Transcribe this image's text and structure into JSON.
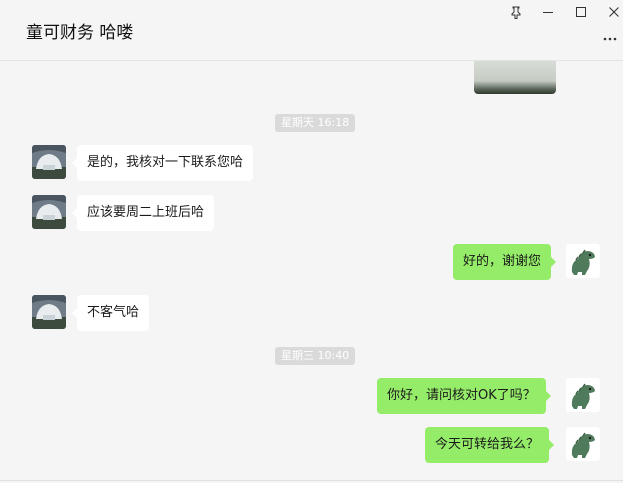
{
  "header": {
    "title": "童可财务 哈喽",
    "pin_icon": "pin-icon",
    "min_icon": "minimize-icon",
    "max_icon": "maximize-icon",
    "close_icon": "close-icon",
    "more_icon": "more-icon"
  },
  "timestamps": [
    "星期天 16:18",
    "星期三 10:40"
  ],
  "messages": [
    {
      "side": "left",
      "text": "是的，我核对一下联系您哈"
    },
    {
      "side": "left",
      "text": "应该要周二上班后哈"
    },
    {
      "side": "right",
      "text": "好的，谢谢您"
    },
    {
      "side": "left",
      "text": "不客气哈"
    },
    {
      "side": "right",
      "text": "你好，请问核对OK了吗？"
    },
    {
      "side": "right",
      "text": "今天可转给我么？"
    }
  ],
  "colors": {
    "right_bubble": "#95ec69",
    "left_bubble": "#ffffff",
    "timestamp_bg": "#dadada",
    "background": "#f5f5f5"
  }
}
